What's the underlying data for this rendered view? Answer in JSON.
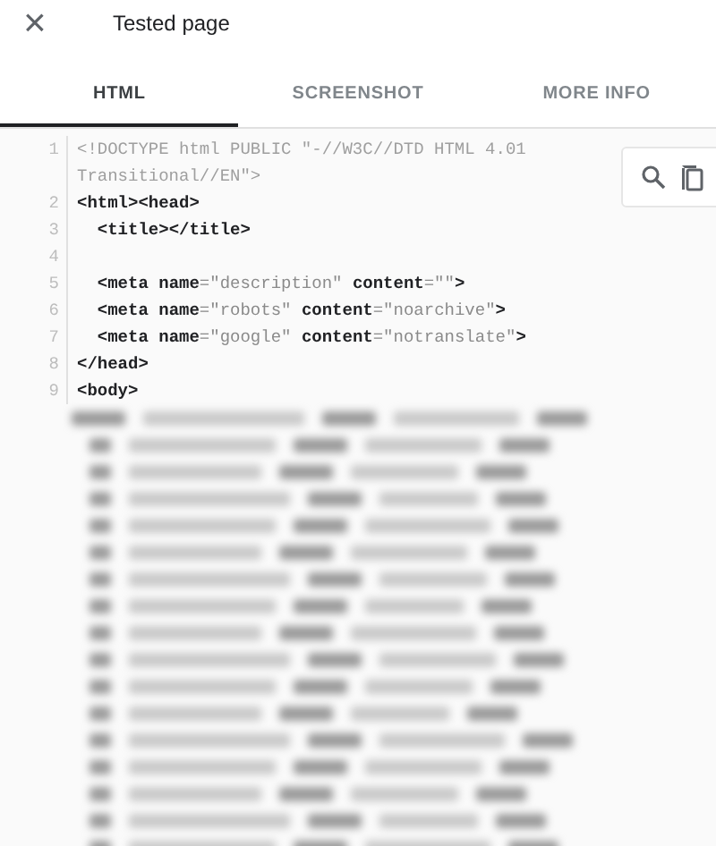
{
  "header": {
    "close_icon": "×",
    "title": "Tested page"
  },
  "tabs": [
    {
      "label": "HTML",
      "selected": true
    },
    {
      "label": "SCREENSHOT",
      "selected": false
    },
    {
      "label": "MORE INFO",
      "selected": false
    }
  ],
  "code": {
    "lines": [
      {
        "number": "1",
        "segments": [
          {
            "kind": "doctype",
            "text": "<!DOCTYPE html PUBLIC \"-//W3C//DTD HTML 4.01 Transitional//EN\">"
          }
        ]
      },
      {
        "number": "2",
        "segments": [
          {
            "kind": "tag",
            "text": "<html><head>"
          }
        ]
      },
      {
        "number": "3",
        "segments": [
          {
            "kind": "tag",
            "text": "  <title></title>"
          }
        ]
      },
      {
        "number": "4"
      },
      {
        "number": "5",
        "segments": [
          {
            "kind": "tag",
            "text": "  <meta name"
          },
          {
            "kind": "value",
            "text": "=\"description\" "
          },
          {
            "kind": "tag",
            "text": "content"
          },
          {
            "kind": "value",
            "text": "=\"\""
          },
          {
            "kind": "tag",
            "text": ">"
          }
        ]
      },
      {
        "number": "6",
        "segments": [
          {
            "kind": "tag",
            "text": "  <meta name"
          },
          {
            "kind": "value",
            "text": "=\"robots\" "
          },
          {
            "kind": "tag",
            "text": "content"
          },
          {
            "kind": "value",
            "text": "=\"noarchive\""
          },
          {
            "kind": "tag",
            "text": ">"
          }
        ]
      },
      {
        "number": "7",
        "segments": [
          {
            "kind": "tag",
            "text": "  <meta name"
          },
          {
            "kind": "value",
            "text": "=\"google\" "
          },
          {
            "kind": "tag",
            "text": "content"
          },
          {
            "kind": "value",
            "text": "=\"notranslate\""
          },
          {
            "kind": "tag",
            "text": ">"
          }
        ]
      },
      {
        "number": "8",
        "segments": [
          {
            "kind": "tag",
            "text": "</head>"
          }
        ]
      },
      {
        "number": "9",
        "segments": [
          {
            "kind": "tag",
            "text": "<body>"
          }
        ]
      }
    ]
  }
}
